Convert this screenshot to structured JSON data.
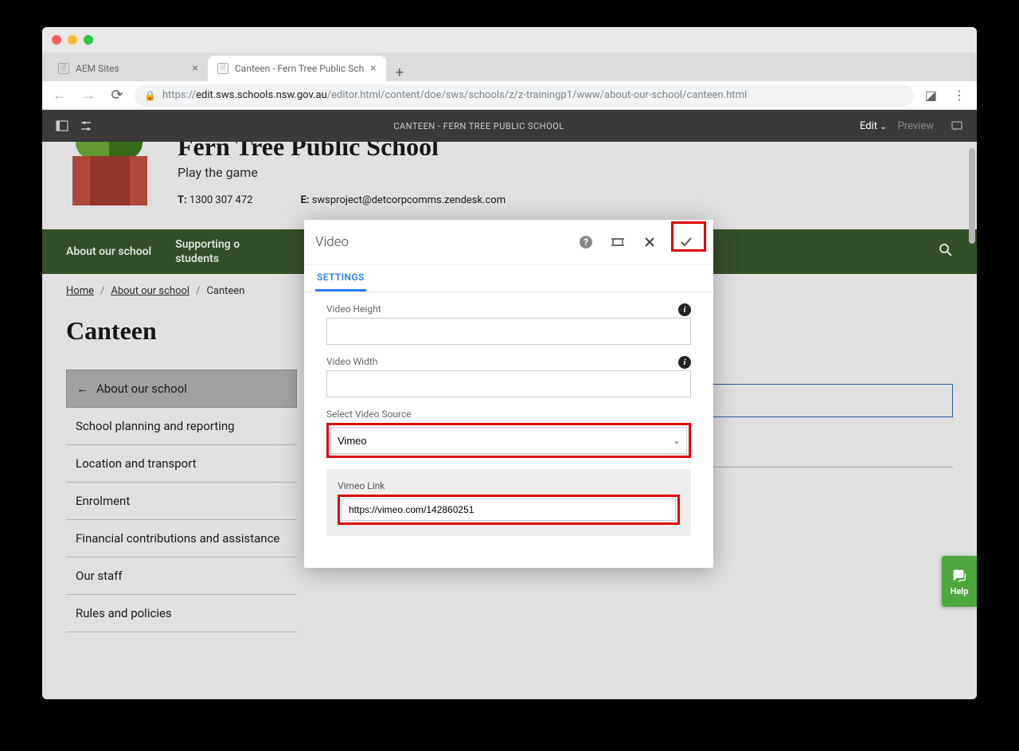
{
  "browser": {
    "tabs": [
      {
        "title": "AEM Sites",
        "active": false
      },
      {
        "title": "Canteen - Fern Tree Public Sch",
        "active": true
      }
    ],
    "url_prefix": "https://",
    "url_host": "edit.sws.schools.nsw.gov.au",
    "url_path": "/editor.html/content/doe/sws/schools/z/z-trainingp1/www/about-our-school/canteen.html"
  },
  "aem": {
    "title": "CANTEEN - FERN TREE PUBLIC SCHOOL",
    "edit": "Edit",
    "preview": "Preview"
  },
  "school": {
    "name": "Fern Tree Public School",
    "tagline": "Play the game",
    "phone_label": "T:",
    "phone": "1300 307 472",
    "email_label": "E:",
    "email": "swsproject@detcorpcomms.zendesk.com"
  },
  "nav": {
    "item1": "About our school",
    "item2": "Supporting o\nstudents"
  },
  "breadcrumb": {
    "home": "Home",
    "about": "About our school",
    "current": "Canteen"
  },
  "page_title": "Canteen",
  "sidenav": [
    "About our school",
    "School planning and reporting",
    "Location and transport",
    "Enrolment",
    "Financial contributions and assistance",
    "Our staff",
    "Rules and policies"
  ],
  "help": "Help",
  "dialog": {
    "title": "Video",
    "tab": "SETTINGS",
    "fields": {
      "height_label": "Video Height",
      "height_value": "",
      "width_label": "Video Width",
      "width_value": "",
      "source_label": "Select Video Source",
      "source_value": "Vimeo",
      "vimeo_label": "Vimeo Link",
      "vimeo_value": "https://vimeo.com/142860251"
    }
  }
}
